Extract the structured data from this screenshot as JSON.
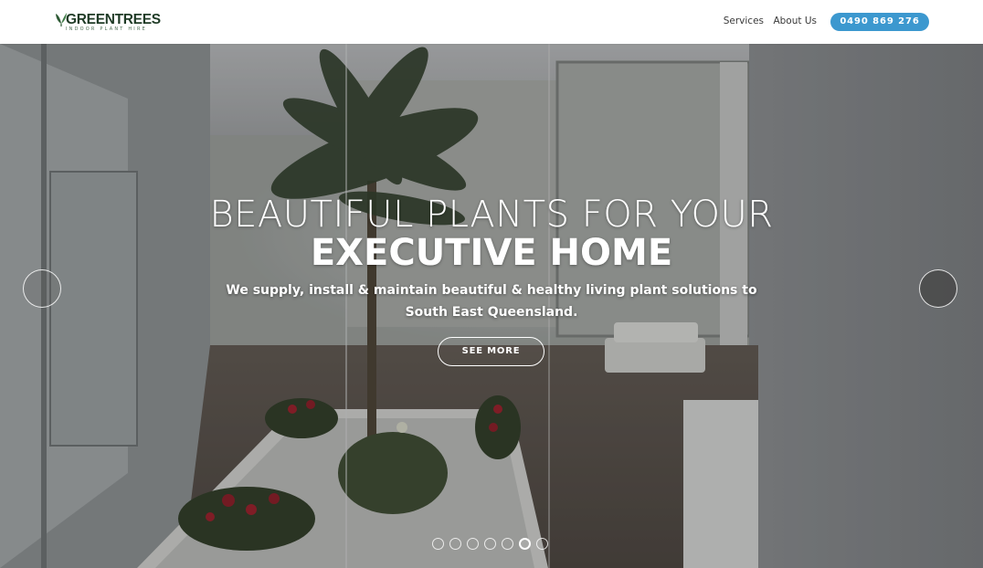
{
  "logo": {
    "name": "GREENTREES",
    "tagline": "INDOOR PLANT HIRE",
    "icon": "leaf-icon"
  },
  "nav": {
    "services_label": "Services",
    "about_label": "About Us",
    "phone_label": "0490 869 276"
  },
  "colors": {
    "brand_green": "#1f3b26",
    "accent_blue": "#3c98cf"
  },
  "hero": {
    "headline_light": "BEAUTIFUL PLANTS FOR YOUR",
    "headline_bold": "EXECUTIVE HOME",
    "tagline": "We supply, install & maintain beautiful & healthy living plant solutions to South East Queensland.",
    "cta_label": "SEE MORE",
    "prev_icon": "circle-prev-arrow-icon",
    "next_icon": "circle-next-arrow-icon"
  },
  "slider": {
    "total_slides": 7,
    "active_slide": 6
  }
}
